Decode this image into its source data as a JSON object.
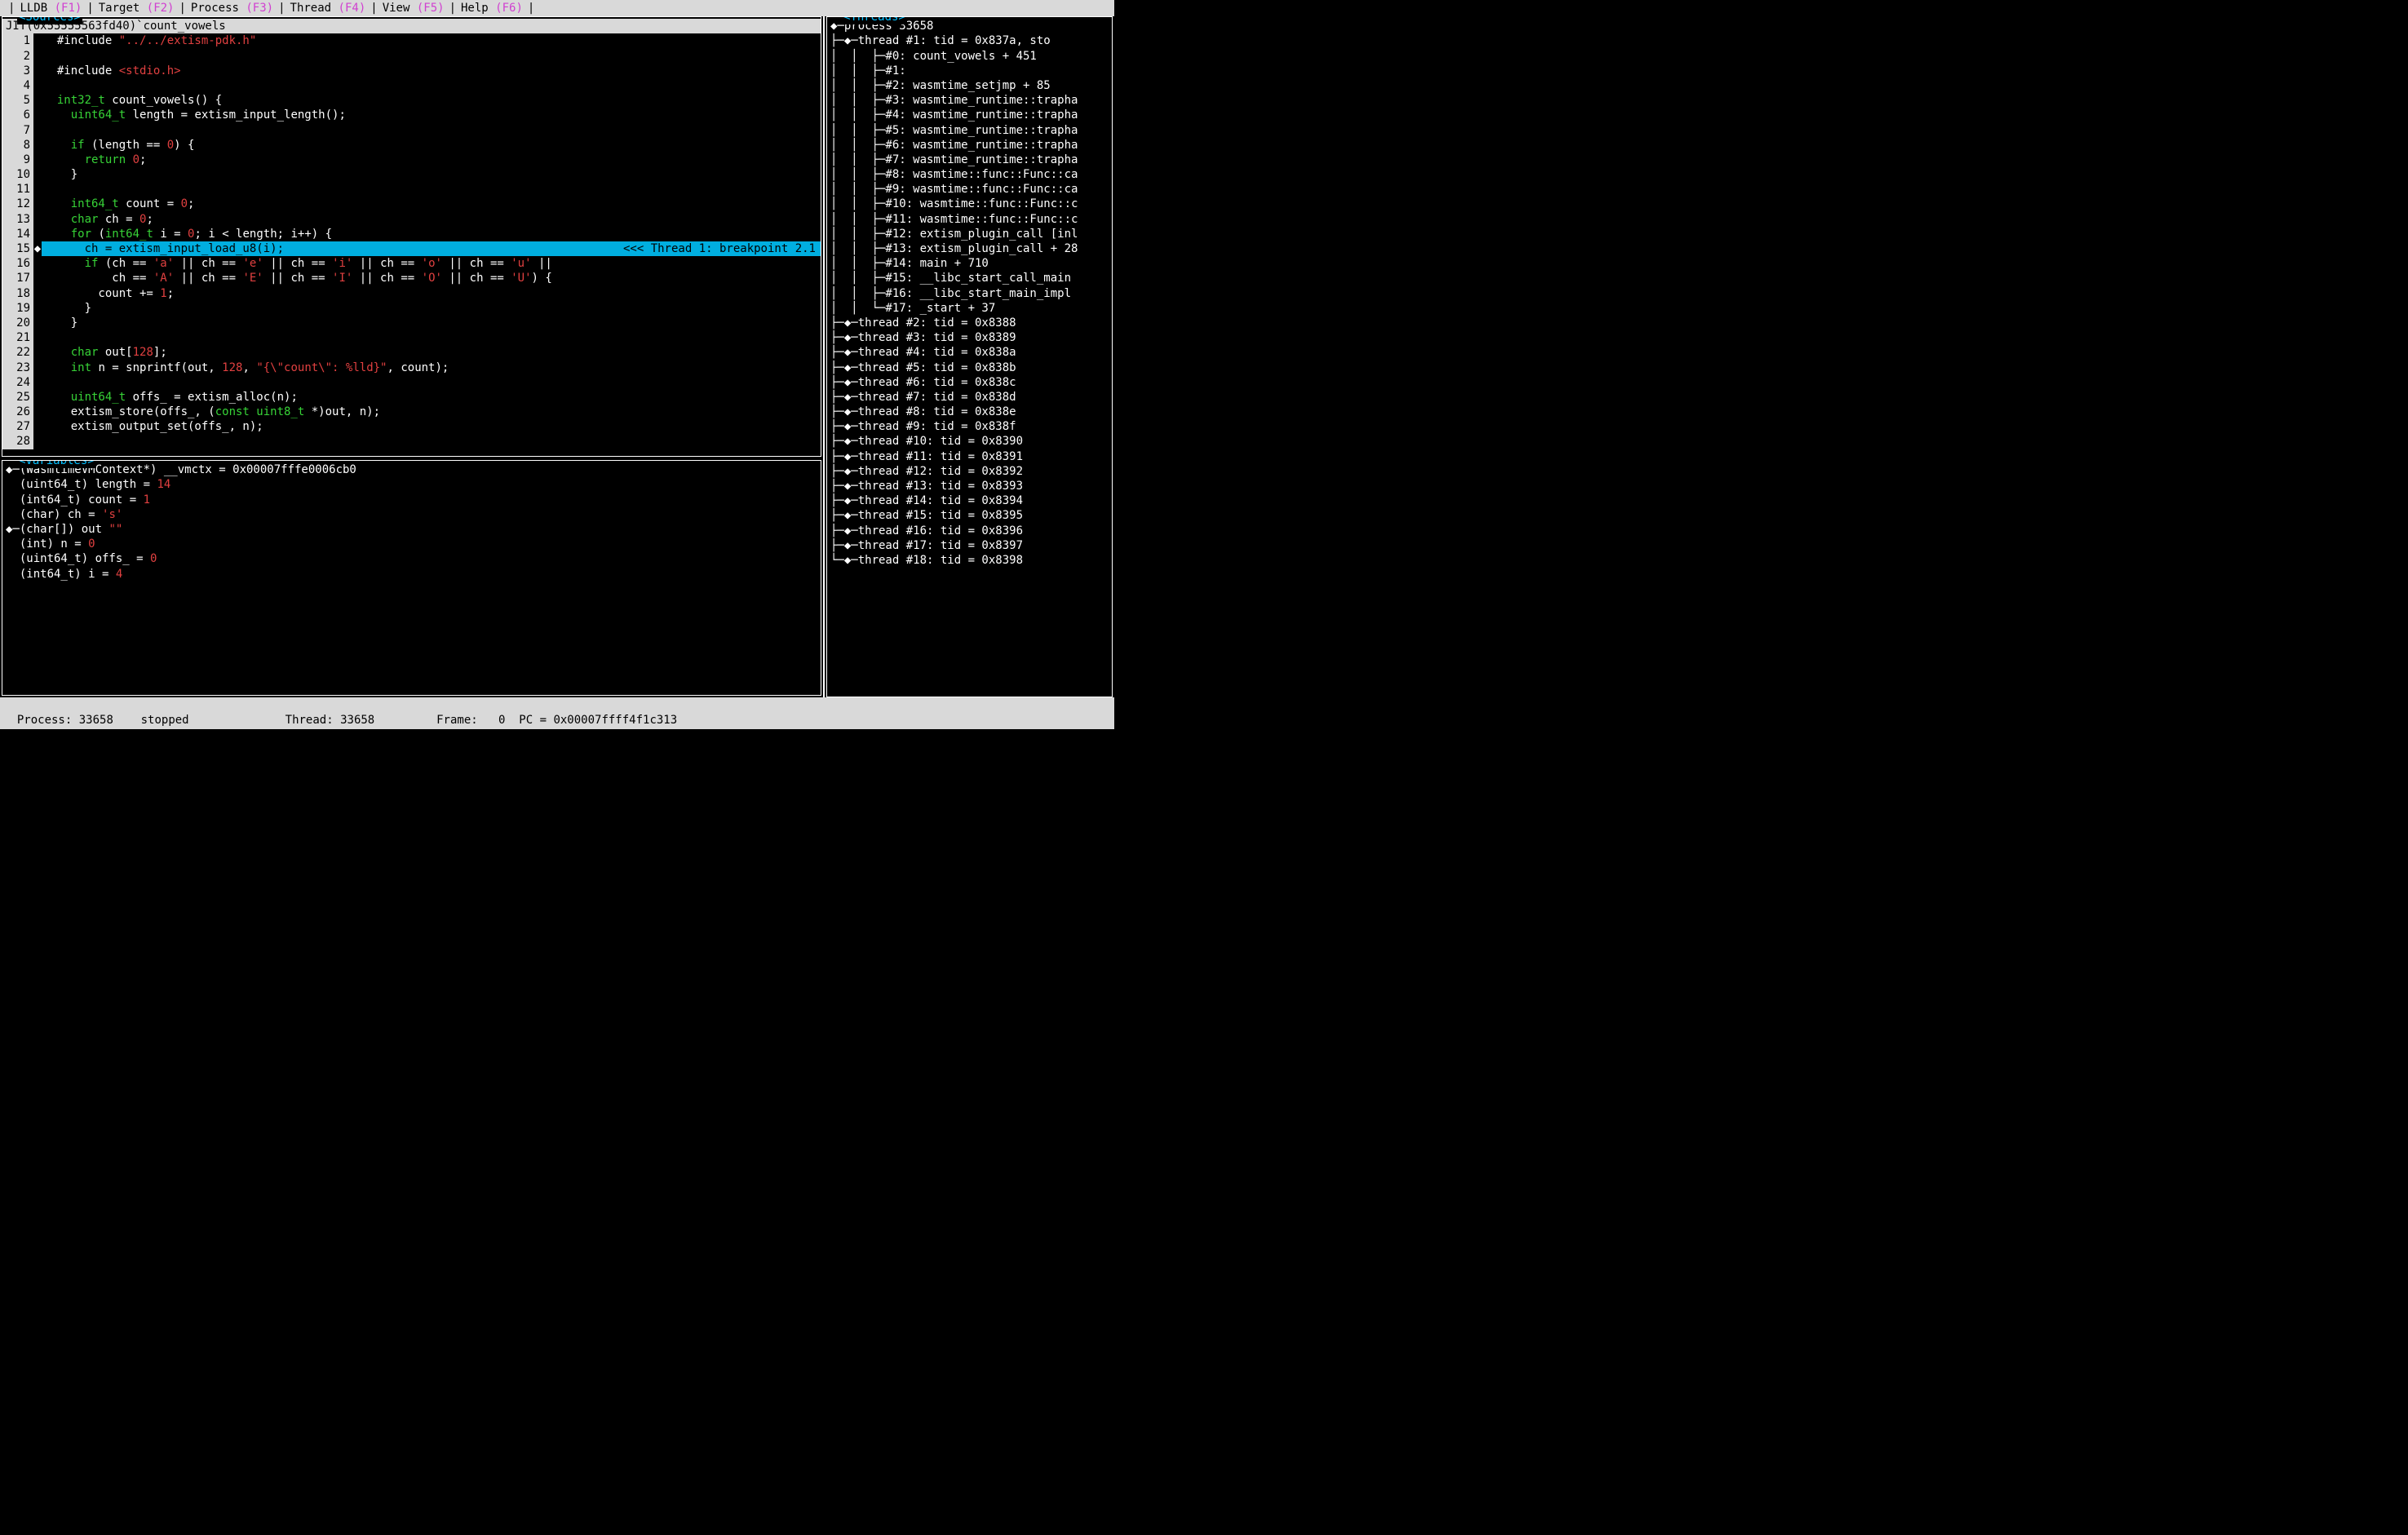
{
  "menu": {
    "items": [
      {
        "label": "LLDB",
        "key": "(F1)"
      },
      {
        "label": "Target",
        "key": "(F2)"
      },
      {
        "label": "Process",
        "key": "(F3)"
      },
      {
        "label": "Thread",
        "key": "(F4)"
      },
      {
        "label": "View",
        "key": "(F5)"
      },
      {
        "label": "Help",
        "key": "(F6)"
      }
    ]
  },
  "panes": {
    "sources_title": "<Sources>",
    "variables_title": "<Variables>",
    "threads_title": "<Threads>"
  },
  "source": {
    "file_header": "JIT(0x55555563fd40)`count_vowels",
    "breakpoint_marker": "<<< Thread 1: breakpoint 2.1",
    "current_line": 15,
    "lines": [
      {
        "n": 1,
        "html": "#include <span class='str'>\"../../extism-pdk.h\"</span>"
      },
      {
        "n": 2,
        "html": ""
      },
      {
        "n": 3,
        "html": "#include <span class='str'>&lt;stdio.h&gt;</span>"
      },
      {
        "n": 4,
        "html": ""
      },
      {
        "n": 5,
        "html": "<span class='kw'>int32_t</span> count_vowels() {"
      },
      {
        "n": 6,
        "html": "  <span class='kw'>uint64_t</span> length = extism_input_length();"
      },
      {
        "n": 7,
        "html": ""
      },
      {
        "n": 8,
        "html": "  <span class='kw'>if</span> (length == <span class='num'>0</span>) {"
      },
      {
        "n": 9,
        "html": "    <span class='kw'>return</span> <span class='num'>0</span>;"
      },
      {
        "n": 10,
        "html": "  }"
      },
      {
        "n": 11,
        "html": ""
      },
      {
        "n": 12,
        "html": "  <span class='kw'>int64_t</span> count = <span class='num'>0</span>;"
      },
      {
        "n": 13,
        "html": "  <span class='kw'>char</span> ch = <span class='num'>0</span>;"
      },
      {
        "n": 14,
        "html": "  <span class='kw'>for</span> (<span class='kw'>int64_t</span> i = <span class='num'>0</span>; i &lt; length; i++) {"
      },
      {
        "n": 15,
        "html": "    ch = extism_input_load_u8(i);"
      },
      {
        "n": 16,
        "html": "    <span class='kw'>if</span> (ch == <span class='str'>'a'</span> || ch == <span class='str'>'e'</span> || ch == <span class='str'>'i'</span> || ch == <span class='str'>'o'</span> || ch == <span class='str'>'u'</span> ||"
      },
      {
        "n": 17,
        "html": "        ch == <span class='str'>'A'</span> || ch == <span class='str'>'E'</span> || ch == <span class='str'>'I'</span> || ch == <span class='str'>'O'</span> || ch == <span class='str'>'U'</span>) {"
      },
      {
        "n": 18,
        "html": "      count += <span class='num'>1</span>;"
      },
      {
        "n": 19,
        "html": "    }"
      },
      {
        "n": 20,
        "html": "  }"
      },
      {
        "n": 21,
        "html": ""
      },
      {
        "n": 22,
        "html": "  <span class='kw'>char</span> out[<span class='num'>128</span>];"
      },
      {
        "n": 23,
        "html": "  <span class='kw'>int</span> n = snprintf(out, <span class='num'>128</span>, <span class='str'>\"{\\\"count\\\": %lld}\"</span>, count);"
      },
      {
        "n": 24,
        "html": ""
      },
      {
        "n": 25,
        "html": "  <span class='kw'>uint64_t</span> offs_ = extism_alloc(n);"
      },
      {
        "n": 26,
        "html": "  extism_store(offs_, (<span class='kw'>const uint8_t</span> *)out, n);"
      },
      {
        "n": 27,
        "html": "  extism_output_set(offs_, n);"
      },
      {
        "n": 28,
        "html": ""
      }
    ]
  },
  "variables": [
    {
      "prefix": "◆─",
      "text": "(WasmtimeVMContext*) __vmctx = 0x00007fffe0006cb0"
    },
    {
      "prefix": "  ",
      "text": "(uint64_t) length = ",
      "val": "14"
    },
    {
      "prefix": "  ",
      "text": "(int64_t) count = ",
      "val": "1"
    },
    {
      "prefix": "  ",
      "text": "(char) ch = ",
      "valstr": "'s'"
    },
    {
      "prefix": "◆─",
      "text": "(char[]) out ",
      "valstr": "\"\""
    },
    {
      "prefix": "  ",
      "text": "(int) n = ",
      "val": "0"
    },
    {
      "prefix": "  ",
      "text": "(uint64_t) offs_ = ",
      "val": "0"
    },
    {
      "prefix": "  ",
      "text": "(int64_t) i = ",
      "val": "4"
    }
  ],
  "threads": {
    "process": "◆─process 33658",
    "thread1": "├─◆─thread #1: tid = 0x837a, sto",
    "frames": [
      "│  ├─#0: count_vowels + 451",
      "│  ├─#1:",
      "│  ├─#2: wasmtime_setjmp + 85",
      "│  ├─#3: wasmtime_runtime::trapha",
      "│  ├─#4: wasmtime_runtime::trapha",
      "│  ├─#5: wasmtime_runtime::trapha",
      "│  ├─#6: wasmtime_runtime::trapha",
      "│  ├─#7: wasmtime_runtime::trapha",
      "│  ├─#8: wasmtime::func::Func::ca",
      "│  ├─#9: wasmtime::func::Func::ca",
      "│  ├─#10: wasmtime::func::Func::c",
      "│  ├─#11: wasmtime::func::Func::c",
      "│  ├─#12: extism_plugin_call [inl",
      "│  ├─#13: extism_plugin_call + 28",
      "│  ├─#14: main + 710",
      "│  ├─#15: __libc_start_call_main ",
      "│  ├─#16: __libc_start_main_impl ",
      "│  └─#17: _start + 37"
    ],
    "others": [
      "├─◆─thread #2: tid = 0x8388",
      "├─◆─thread #3: tid = 0x8389",
      "├─◆─thread #4: tid = 0x838a",
      "├─◆─thread #5: tid = 0x838b",
      "├─◆─thread #6: tid = 0x838c",
      "├─◆─thread #7: tid = 0x838d",
      "├─◆─thread #8: tid = 0x838e",
      "├─◆─thread #9: tid = 0x838f",
      "├─◆─thread #10: tid = 0x8390",
      "├─◆─thread #11: tid = 0x8391",
      "├─◆─thread #12: tid = 0x8392",
      "├─◆─thread #13: tid = 0x8393",
      "├─◆─thread #14: tid = 0x8394",
      "├─◆─thread #15: tid = 0x8395",
      "├─◆─thread #16: tid = 0x8396",
      "├─◆─thread #17: tid = 0x8397",
      "└─◆─thread #18: tid = 0x8398"
    ]
  },
  "status": {
    "process_label": "Process:",
    "process_id": "33658",
    "process_state": "stopped",
    "thread_label": "Thread:",
    "thread_id": "33658",
    "frame_label": "Frame:",
    "frame_num": "0",
    "pc_label": "PC =",
    "pc_val": "0x00007ffff4f1c313"
  }
}
